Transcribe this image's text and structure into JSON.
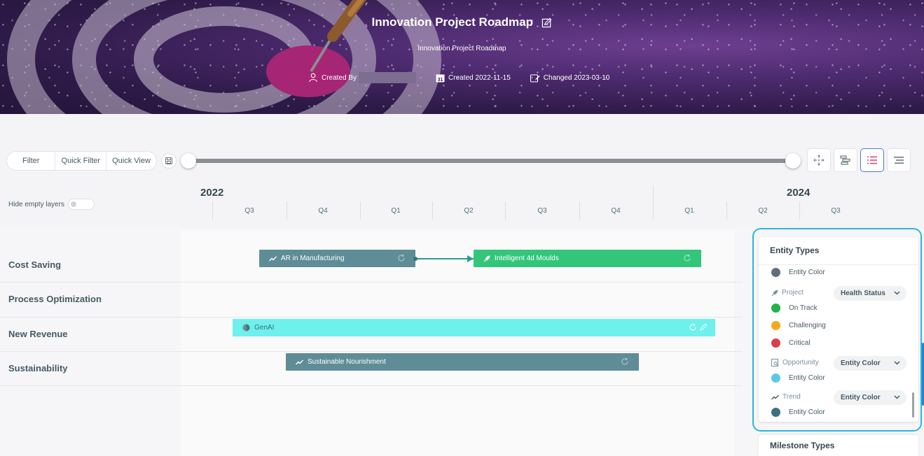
{
  "header": {
    "title": "Innovation Project Roadmap",
    "subtitle": "Innovation Project Roadmap",
    "created_by_label": "Created By",
    "created_label": "Created 2022-11-15",
    "changed_label": "Changed 2023-03-10"
  },
  "toolbar": {
    "filter": "Filter",
    "quick_filter": "Quick Filter",
    "quick_view": "Quick View"
  },
  "timeline": {
    "hide_empty_label": "Hide empty layers",
    "years": [
      "2022",
      "2024"
    ],
    "quarters": [
      "Q3",
      "Q4",
      "Q1",
      "Q2",
      "Q3",
      "Q4",
      "Q1",
      "Q2",
      "Q3"
    ]
  },
  "rows": [
    {
      "label": "Cost Saving"
    },
    {
      "label": "Process Optimization"
    },
    {
      "label": "New Revenue"
    },
    {
      "label": "Sustainability"
    }
  ],
  "bars": {
    "ar": {
      "label": "AR in Manufacturing",
      "color": "#5f8d97",
      "type": "trend"
    },
    "moulds": {
      "label": "Intelligent 4d Moulds",
      "color": "#33c67a",
      "type": "project"
    },
    "genai": {
      "label": "GenAI",
      "color": "#6ef0ec",
      "type": "opportunity"
    },
    "nourish": {
      "label": "Sustainable Nourishment",
      "color": "#5f8d97",
      "type": "trend"
    }
  },
  "legend": {
    "title": "Entity Types",
    "top_partial": "Entity Color",
    "project_type": "Project",
    "project_select": "Health Status",
    "on_track": "On Track",
    "challenging": "Challenging",
    "critical": "Critical",
    "opportunity_type": "Opportunity",
    "opportunity_select": "Entity Color",
    "opportunity_entity": "Entity Color",
    "trend_type": "Trend",
    "trend_select": "Entity Color",
    "trend_entity": "Entity Color",
    "milestone_title": "Milestone Types",
    "colors": {
      "on_track": "#22b24c",
      "challenging": "#f4a91d",
      "critical": "#d8404a",
      "opportunity": "#5bc8e8",
      "trend": "#3f7080"
    }
  }
}
